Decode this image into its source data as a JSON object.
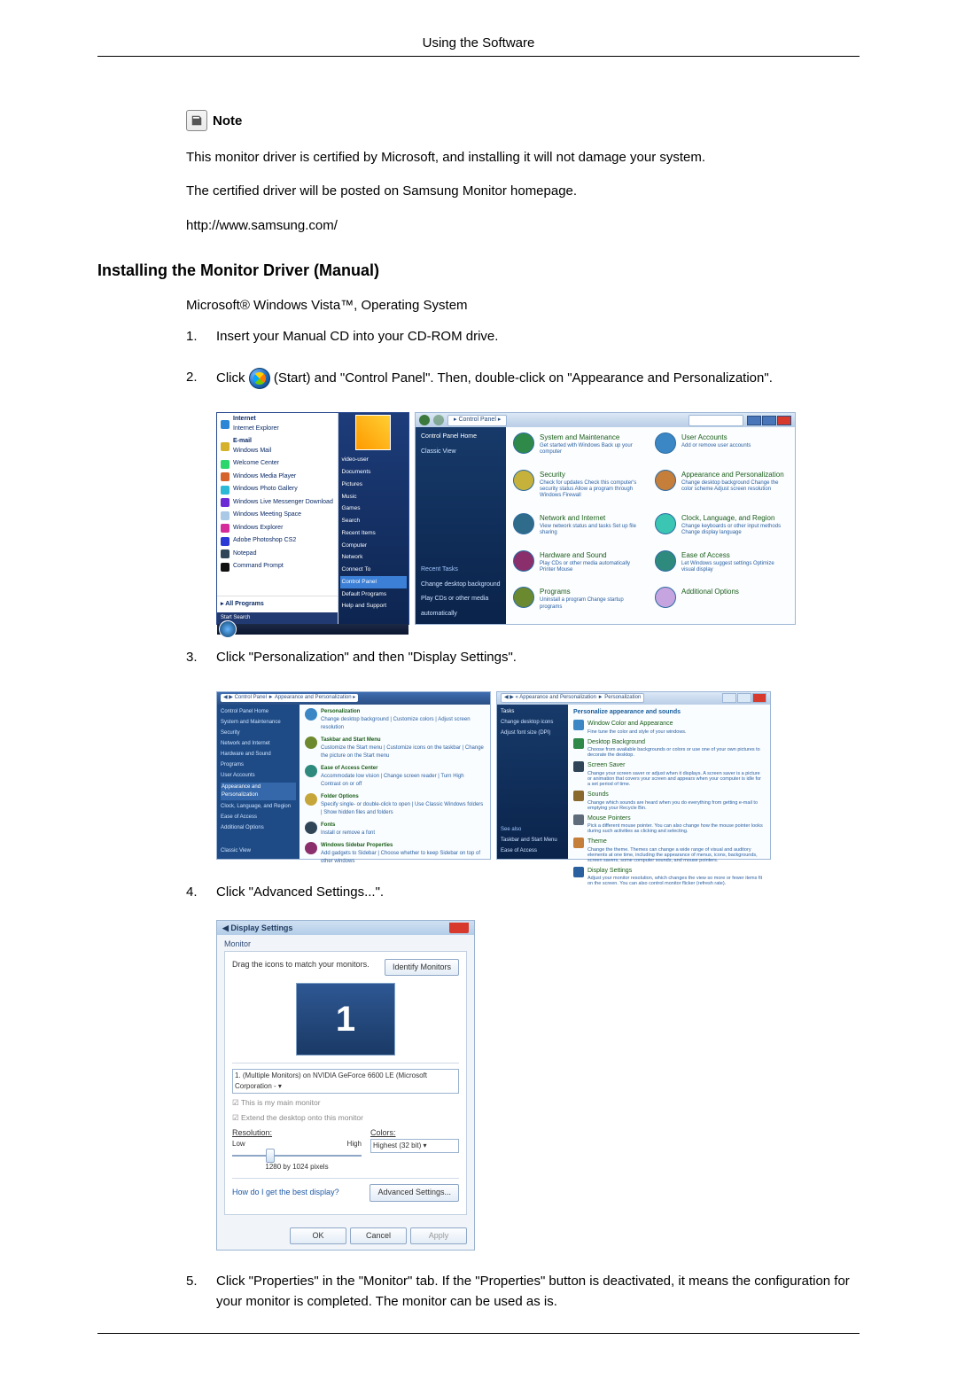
{
  "header": {
    "running_title": "Using the Software"
  },
  "note": {
    "label": "Note",
    "lines": [
      "This monitor driver is certified by Microsoft, and installing it will not damage your system.",
      "The certified driver will be posted on Samsung Monitor homepage.",
      "http://www.samsung.com/"
    ]
  },
  "section": {
    "heading": "Installing the Monitor Driver (Manual)",
    "intro": "Microsoft® Windows Vista™, Operating System",
    "steps": [
      "Insert your Manual CD into your CD-ROM drive.",
      {
        "pre": "Click ",
        "mid": "(Start) and \"Control Panel\". Then, double-click on \"Appearance and Personalization\"."
      },
      "Click \"Personalization\" and then \"Display Settings\".",
      "Click \"Advanced Settings...\".",
      "Click \"Properties\" in the \"Monitor\" tab. If the \"Properties\" button is deactivated, it means the configuration for your monitor is completed. The monitor can be used as is."
    ]
  },
  "start_menu": {
    "left": [
      "Internet",
      "Internet Explorer",
      "E-mail",
      "Windows Mail",
      "Welcome Center",
      "Windows Media Player",
      "Windows Photo Gallery",
      "Windows Live Messenger Download",
      "Windows Meeting Space",
      "Windows Explorer",
      "Adobe Photoshop CS2",
      "Notepad",
      "Command Prompt"
    ],
    "all_programs": "All Programs",
    "search": "Start Search",
    "right": [
      "video-user",
      "Documents",
      "Pictures",
      "Music",
      "Games",
      "Search",
      "Recent Items",
      "Computer",
      "Network",
      "Connect To",
      "Control Panel",
      "Default Programs",
      "Help and Support"
    ]
  },
  "control_panel": {
    "address": "Control Panel",
    "side": {
      "home": "Control Panel Home",
      "classic": "Classic View",
      "recent": "Recent Tasks",
      "tasks": [
        "Change desktop background",
        "Play CDs or other media",
        "automatically"
      ]
    },
    "cats": {
      "sys": {
        "title": "System and Maintenance",
        "sub": "Get started with Windows\nBack up your computer"
      },
      "user": {
        "title": "User Accounts",
        "sub": "Add or remove user accounts"
      },
      "sec": {
        "title": "Security",
        "sub": "Check for updates\nCheck this computer's security status\nAllow a program through Windows Firewall"
      },
      "appear": {
        "title": "Appearance and Personalization",
        "sub": "Change desktop background\nChange the color scheme\nAdjust screen resolution"
      },
      "net": {
        "title": "Network and Internet",
        "sub": "View network status and tasks\nSet up file sharing"
      },
      "clock": {
        "title": "Clock, Language, and Region",
        "sub": "Change keyboards or other input methods\nChange display language"
      },
      "hw": {
        "title": "Hardware and Sound",
        "sub": "Play CDs or other media automatically\nPrinter\nMouse"
      },
      "ease": {
        "title": "Ease of Access",
        "sub": "Let Windows suggest settings\nOptimize visual display"
      },
      "prog": {
        "title": "Programs",
        "sub": "Uninstall a program\nChange startup programs"
      },
      "addl": {
        "title": "Additional Options"
      }
    }
  },
  "personalization_left": {
    "breadcrumb": "Control Panel ► Appearance and Personalization",
    "side": [
      "Control Panel Home",
      "System and Maintenance",
      "Security",
      "Network and Internet",
      "Hardware and Sound",
      "Programs",
      "User Accounts",
      "Appearance and Personalization",
      "Clock, Language, and Region",
      "Ease of Access",
      "Additional Options"
    ],
    "classic": "Classic View",
    "items": [
      {
        "t": "Personalization",
        "s": "Change desktop background | Customize colors | Adjust screen resolution"
      },
      {
        "t": "Taskbar and Start Menu",
        "s": "Customize the Start menu | Customize icons on the taskbar | Change the picture on the Start menu"
      },
      {
        "t": "Ease of Access Center",
        "s": "Accommodate low vision | Change screen reader | Turn High Contrast on or off"
      },
      {
        "t": "Folder Options",
        "s": "Specify single- or double-click to open | Use Classic Windows folders | Show hidden files and folders"
      },
      {
        "t": "Fonts",
        "s": "Install or remove a font"
      },
      {
        "t": "Windows Sidebar Properties",
        "s": "Add gadgets to Sidebar | Choose whether to keep Sidebar on top of other windows"
      }
    ]
  },
  "personalization_right": {
    "breadcrumb": "Appearance and Personalization ► Personalization",
    "side": {
      "head": "Tasks",
      "items": [
        "Change desktop icons",
        "Adjust font size (DPI)"
      ],
      "seealso": "See also",
      "seeitems": [
        "Taskbar and Start Menu",
        "Ease of Access"
      ]
    },
    "heading": "Personalize appearance and sounds",
    "items": [
      {
        "t": "Window Color and Appearance",
        "s": "Fine tune the color and style of your windows."
      },
      {
        "t": "Desktop Background",
        "s": "Choose from available backgrounds or colors or use one of your own pictures to decorate the desktop."
      },
      {
        "t": "Screen Saver",
        "s": "Change your screen saver or adjust when it displays. A screen saver is a picture or animation that covers your screen and appears when your computer is idle for a set period of time."
      },
      {
        "t": "Sounds",
        "s": "Change which sounds are heard when you do everything from getting e-mail to emptying your Recycle Bin."
      },
      {
        "t": "Mouse Pointers",
        "s": "Pick a different mouse pointer. You can also change how the mouse pointer looks during such activities as clicking and selecting."
      },
      {
        "t": "Theme",
        "s": "Change the theme. Themes can change a wide range of visual and auditory elements at one time, including the appearance of menus, icons, backgrounds, screen savers, some computer sounds, and mouse pointers."
      },
      {
        "t": "Display Settings",
        "s": "Adjust your monitor resolution, which changes the view so more or fewer items fit on the screen. You can also control monitor flicker (refresh rate)."
      }
    ]
  },
  "display_settings": {
    "title": "Display Settings",
    "tab": "Monitor",
    "drag": "Drag the icons to match your monitors.",
    "identify": "Identify Monitors",
    "monitor_number": "1",
    "dropdown": "1. (Multiple Monitors) on NVIDIA GeForce 6600 LE (Microsoft Corporation -  ▾",
    "chk_main": "This is my main monitor",
    "chk_extend": "Extend the desktop onto this monitor",
    "resolution_label": "Resolution:",
    "low": "Low",
    "high": "High",
    "resolution_value": "1280 by 1024 pixels",
    "colors_label": "Colors:",
    "colors_value": "Highest (32 bit)",
    "help_link": "How do I get the best display?",
    "advanced": "Advanced Settings...",
    "ok": "OK",
    "cancel": "Cancel",
    "apply": "Apply"
  }
}
